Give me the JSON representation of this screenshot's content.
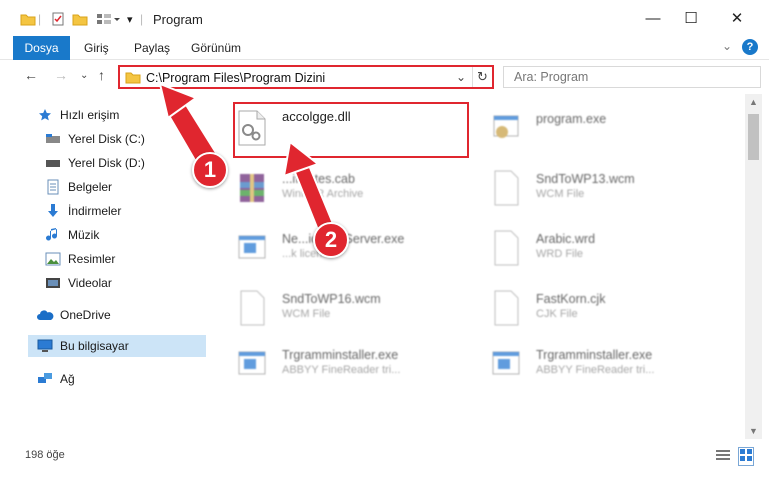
{
  "window": {
    "title": "Program",
    "minimize": "—",
    "maximize": "☐",
    "close": "✕"
  },
  "ribbon": {
    "tabs": [
      "Dosya",
      "Giriş",
      "Paylaş",
      "Görünüm"
    ],
    "help": "?"
  },
  "address": {
    "path": "C:\\Program Files\\Program Dizini",
    "search_placeholder": "Ara: Program"
  },
  "sidebar": {
    "items": [
      {
        "label": "Hızlı erişim",
        "icon": "star-icon"
      },
      {
        "label": "Yerel Disk (C:)",
        "icon": "drive-icon"
      },
      {
        "label": "Yerel Disk (D:)",
        "icon": "drive-icon"
      },
      {
        "label": "Belgeler",
        "icon": "document-icon"
      },
      {
        "label": "İndirmeler",
        "icon": "download-icon"
      },
      {
        "label": "Müzik",
        "icon": "music-icon"
      },
      {
        "label": "Resimler",
        "icon": "picture-icon"
      },
      {
        "label": "Videolar",
        "icon": "video-icon"
      },
      {
        "label": "OneDrive",
        "icon": "cloud-icon"
      },
      {
        "label": "Bu bilgisayar",
        "icon": "computer-icon"
      },
      {
        "label": "Ağ",
        "icon": "network-icon"
      }
    ]
  },
  "files": [
    {
      "name": "accolgge.dll",
      "type": ""
    },
    {
      "name": "program.exe",
      "type": ""
    },
    {
      "name": "...ificates.cab",
      "type": "WinRAR Archive"
    },
    {
      "name": "SndToWP13.wcm",
      "type": "WCM File"
    },
    {
      "name": "Ne...icenseServer.exe",
      "type": "...k licen..."
    },
    {
      "name": "Arabic.wrd",
      "type": "WRD File"
    },
    {
      "name": "SndToWP16.wcm",
      "type": "WCM File"
    },
    {
      "name": "FastKorn.cjk",
      "type": "CJK File"
    },
    {
      "name": "Trgramminstaller.exe",
      "type": "ABBYY FineReader tri..."
    },
    {
      "name": "Trgramminstaller.exe",
      "type": "ABBYY FineReader tri..."
    }
  ],
  "status": {
    "count": "198 öğe"
  },
  "annotations": {
    "step1": "1",
    "step2": "2"
  },
  "colors": {
    "accent": "#1979ca",
    "annotation": "#e0262f"
  }
}
